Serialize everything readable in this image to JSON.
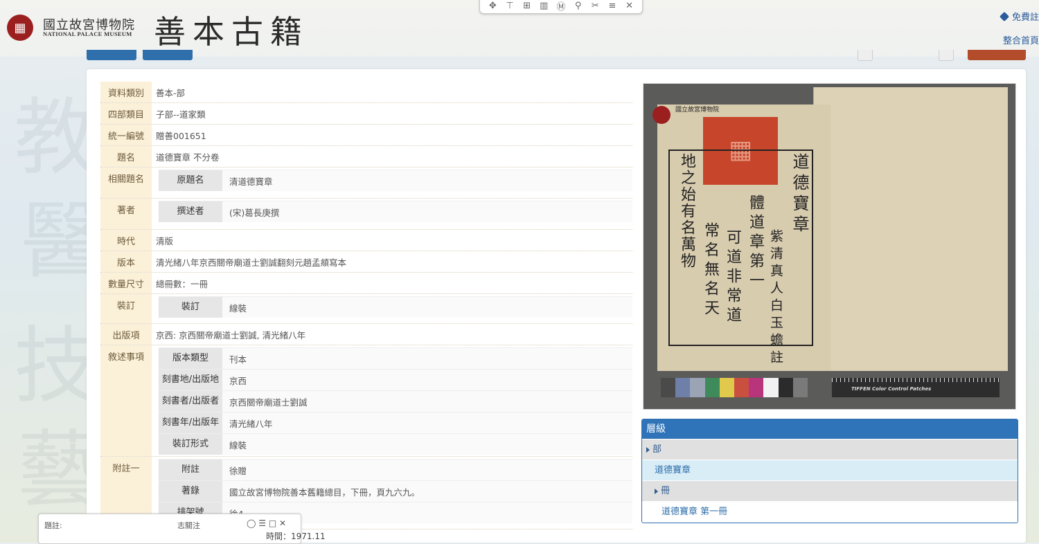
{
  "header": {
    "museum_name_zh": "國立故宮博物院",
    "museum_name_en": "NATIONAL PALACE MUSEUM",
    "site_title": "善本古籍",
    "link_free": "免費註",
    "link_home": "整合首頁"
  },
  "toolbar_icons": [
    "move-icon",
    "text-cursor-icon",
    "grid-icon",
    "columns-icon",
    "marker-icon",
    "zoom-icon",
    "scissors-icon",
    "menu-icon",
    "close-icon"
  ],
  "metadata": {
    "rows": [
      {
        "label": "資料類別",
        "value": "善本-部"
      },
      {
        "label": "四部類目",
        "value": "子部--道家類"
      },
      {
        "label": "統一編號",
        "value": "贈善001651"
      },
      {
        "label": "題名",
        "value": "道德寶章 不分卷"
      },
      {
        "label": "相關題名",
        "sub": [
          {
            "label": "原題名",
            "value": "清道德寶章"
          }
        ]
      },
      {
        "label": "著者",
        "sub": [
          {
            "label": "撰述者",
            "value": "(宋)葛長庚撰"
          }
        ]
      },
      {
        "label": "時代",
        "value": "清版"
      },
      {
        "label": "版本",
        "value": "清光緒八年京西關帝廟道士劉誠翻刻元趙孟頫寫本"
      },
      {
        "label": "數量尺寸",
        "value": "總冊數：一冊"
      },
      {
        "label": "裝訂",
        "sub": [
          {
            "label": "裝訂",
            "value": "線裝"
          }
        ]
      },
      {
        "label": "出版項",
        "value": "京西: 京西關帝廟道士劉誠, 清光緒八年"
      },
      {
        "label": "敘述事項",
        "sub": [
          {
            "label": "版本類型",
            "value": "刊本"
          },
          {
            "label": "刻書地/出版地",
            "value": "京西"
          },
          {
            "label": "刻書者/出版者",
            "value": "京西關帝廟道士劉誠"
          },
          {
            "label": "刻書年/出版年",
            "value": "清光緒八年"
          },
          {
            "label": "裝訂形式",
            "value": "線裝"
          }
        ]
      },
      {
        "label": "附註一",
        "sub": [
          {
            "label": "附註",
            "value": "徐贈"
          },
          {
            "label": "著錄",
            "value": "國立故宮博物院善本舊籍總目，下冊，頁九六九。"
          },
          {
            "label": "排架號",
            "value": "徐4"
          }
        ]
      }
    ]
  },
  "image_text": {
    "museum_label": "國立故宮博物院",
    "col1": "道德寶章",
    "col2": "紫清真人白玉蟾註",
    "col3": "體道章第一",
    "col4": "可道非常道",
    "col5": "常名無名天",
    "col6": "地之始有名萬物",
    "ruler_label": "TIFFEN Color Control Patches"
  },
  "colors": {
    "patches": [
      "#4a4a4a",
      "#6e7fa8",
      "#9aa4b5",
      "#3e8a5a",
      "#e0c94b",
      "#c94f3f",
      "#b8357b",
      "#f2f2f2",
      "#2b2b2b",
      "#7a7a7a"
    ]
  },
  "hierarchy": {
    "title": "層級",
    "items": [
      {
        "label": "部",
        "style": "gray"
      },
      {
        "label": "道德寶章",
        "style": "light"
      },
      {
        "label": "冊",
        "style": "gray"
      },
      {
        "label": "道德寶章 第一冊",
        "style": "white"
      }
    ]
  },
  "bottom": {
    "left_label": "題註:",
    "mid_label": "志關注",
    "time": "時間：1971.11"
  }
}
